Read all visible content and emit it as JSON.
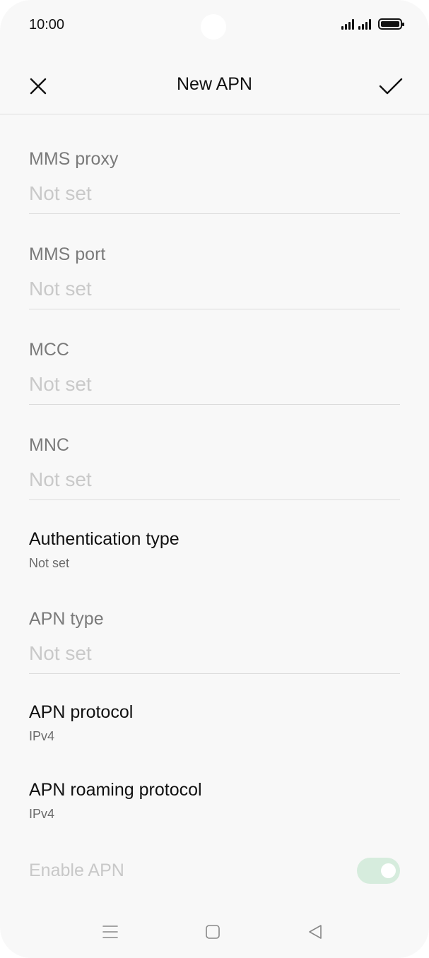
{
  "status_bar": {
    "time": "10:00",
    "icons": [
      "signal-icon",
      "signal-icon",
      "battery-icon"
    ]
  },
  "header": {
    "title": "New APN",
    "close_icon": "close-icon",
    "confirm_icon": "checkmark-icon"
  },
  "fields": [
    {
      "label": "MMS proxy",
      "value": "",
      "placeholder": "Not set"
    },
    {
      "label": "MMS port",
      "value": "",
      "placeholder": "Not set"
    },
    {
      "label": "MCC",
      "value": "",
      "placeholder": "Not set"
    },
    {
      "label": "MNC",
      "value": "",
      "placeholder": "Not set"
    }
  ],
  "authentication_type": {
    "label": "Authentication type",
    "value": "Not set"
  },
  "apn_type": {
    "label": "APN type",
    "value": "",
    "placeholder": "Not set"
  },
  "apn_protocol": {
    "label": "APN protocol",
    "value": "IPv4"
  },
  "apn_roaming_protocol": {
    "label": "APN roaming protocol",
    "value": "IPv4"
  },
  "enable_apn": {
    "label": "Enable APN",
    "enabled": true,
    "disabled_state": true
  },
  "colors": {
    "toggle_track": "#d6ecdd",
    "background": "#f8f8f8"
  },
  "navbar": {
    "icons": [
      "menu-icon",
      "home-icon",
      "back-icon"
    ]
  }
}
